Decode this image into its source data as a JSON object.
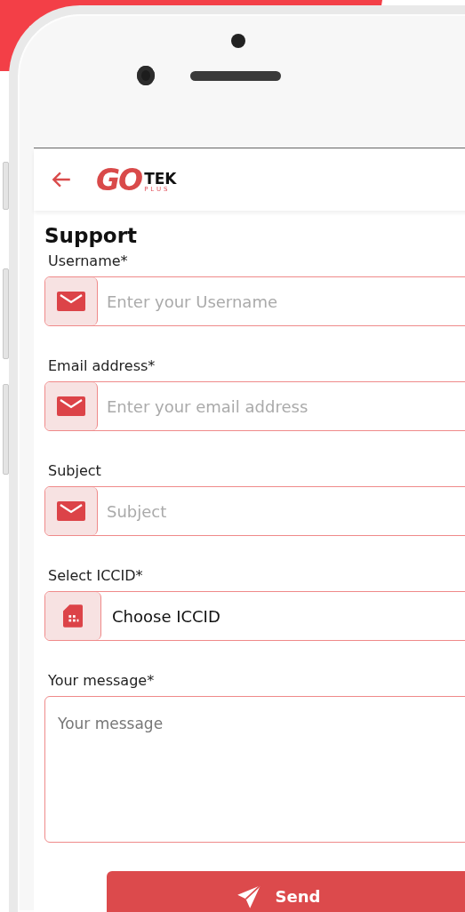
{
  "header": {
    "logo": {
      "go": "GO",
      "tek": "TEK",
      "plus": "PLUS"
    }
  },
  "page_title": "Support",
  "fields": [
    {
      "kind": "text",
      "label": "Username*",
      "placeholder": "Enter your Username"
    },
    {
      "kind": "text",
      "label": "Email address*",
      "placeholder": "Enter your email address"
    },
    {
      "kind": "text",
      "label": "Subject",
      "placeholder": "Subject"
    },
    {
      "kind": "select",
      "label": "Select ICCID*",
      "value": "Choose ICCID"
    },
    {
      "kind": "textarea",
      "label": "Your message*",
      "placeholder": "Your message"
    }
  ],
  "send_button": {
    "label": "Send"
  }
}
